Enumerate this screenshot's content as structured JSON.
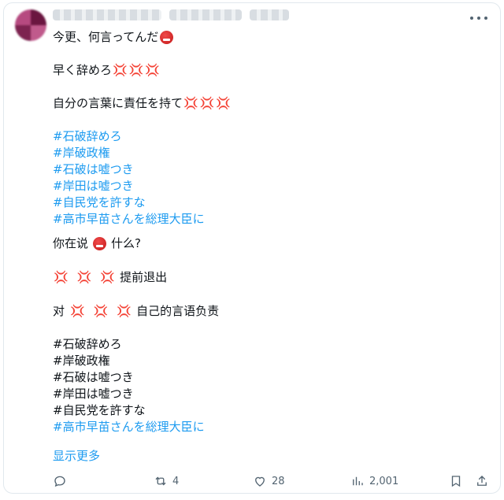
{
  "post": {
    "ja_line1": "今更、何言ってんだ",
    "ja_line2": "早く辞めろ",
    "ja_line3": "自分の言葉に責任を持て",
    "hashtags_ja": [
      "#石破辞めろ",
      "#岸破政権",
      "#石破は嘘つき",
      "#岸田は嘘つき",
      "#自民党を許すな",
      "#高市早苗さんを総理大臣に"
    ],
    "zh_line1_a": "你在说",
    "zh_line1_b": "什么?",
    "zh_line2": "提前退出",
    "zh_line3_a": "对",
    "zh_line3_b": "自己的言语负责",
    "hashtags_zh": [
      "#石破辞めろ",
      "#岸破政権",
      "#石破は嘘つき",
      "#岸田は嘘つき",
      "#自民党を許すな",
      "#高市早苗さんを総理大臣に"
    ],
    "show_more": "显示更多"
  },
  "icons": {
    "anger_symbol": "💢"
  },
  "actions": {
    "reply_count": "",
    "retweet_count": "4",
    "like_count": "28",
    "views_count": "2,001"
  },
  "colors": {
    "link_blue": "#1d9bf0",
    "muted": "#536471",
    "text": "#0f1419"
  }
}
